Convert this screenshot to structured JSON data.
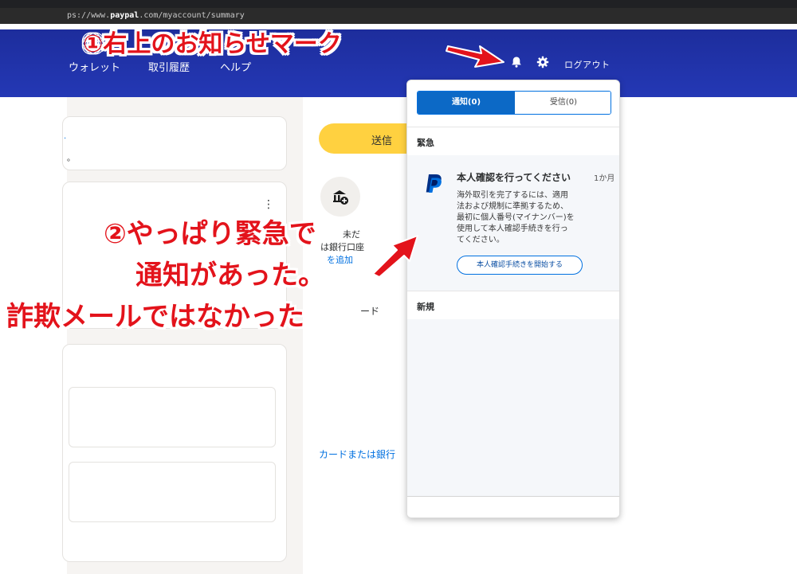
{
  "browser": {
    "url_prefix": "ps://www.",
    "url_host": "paypal",
    "url_suffix": ".com/myaccount/summary"
  },
  "nav": {
    "links": [
      "ウォレット",
      "取引履歴",
      "ヘルプ"
    ],
    "logout_label": "ログアウト",
    "bar_color": "#1f2fa8"
  },
  "left": {
    "card1_lines": [
      ".",
      "。"
    ],
    "kebab": "⋮"
  },
  "right": {
    "send_label": "送信",
    "bank_lines": [
      "未だ",
      "は銀行口座",
      "を追加"
    ],
    "card_text": "ードまたは銀行口座",
    "card_fragment": "ード",
    "link_text": "カードまたは銀行"
  },
  "panel": {
    "tab_notifications": "通知(0)",
    "tab_inbox": "受信(0)",
    "section_urgent": "緊急",
    "notification": {
      "title": "本人確認を行ってください",
      "time": "1か月",
      "body": [
        "海外取引を完了するには、適用",
        "法および規制に準拠するため、",
        "最初に個人番号(マイナンバー)を",
        "使用して本人確認手続きを行っ",
        "てください。"
      ],
      "button": "本人確認手続きを開始する"
    },
    "section_new": "新規"
  },
  "annotations": {
    "one": "①右上のお知らせマーク",
    "two_line1": "②やっぱり緊急で",
    "two_line2": "通知があった。",
    "two_line3": "詐欺メールではなかった",
    "color": "#e3131b"
  }
}
